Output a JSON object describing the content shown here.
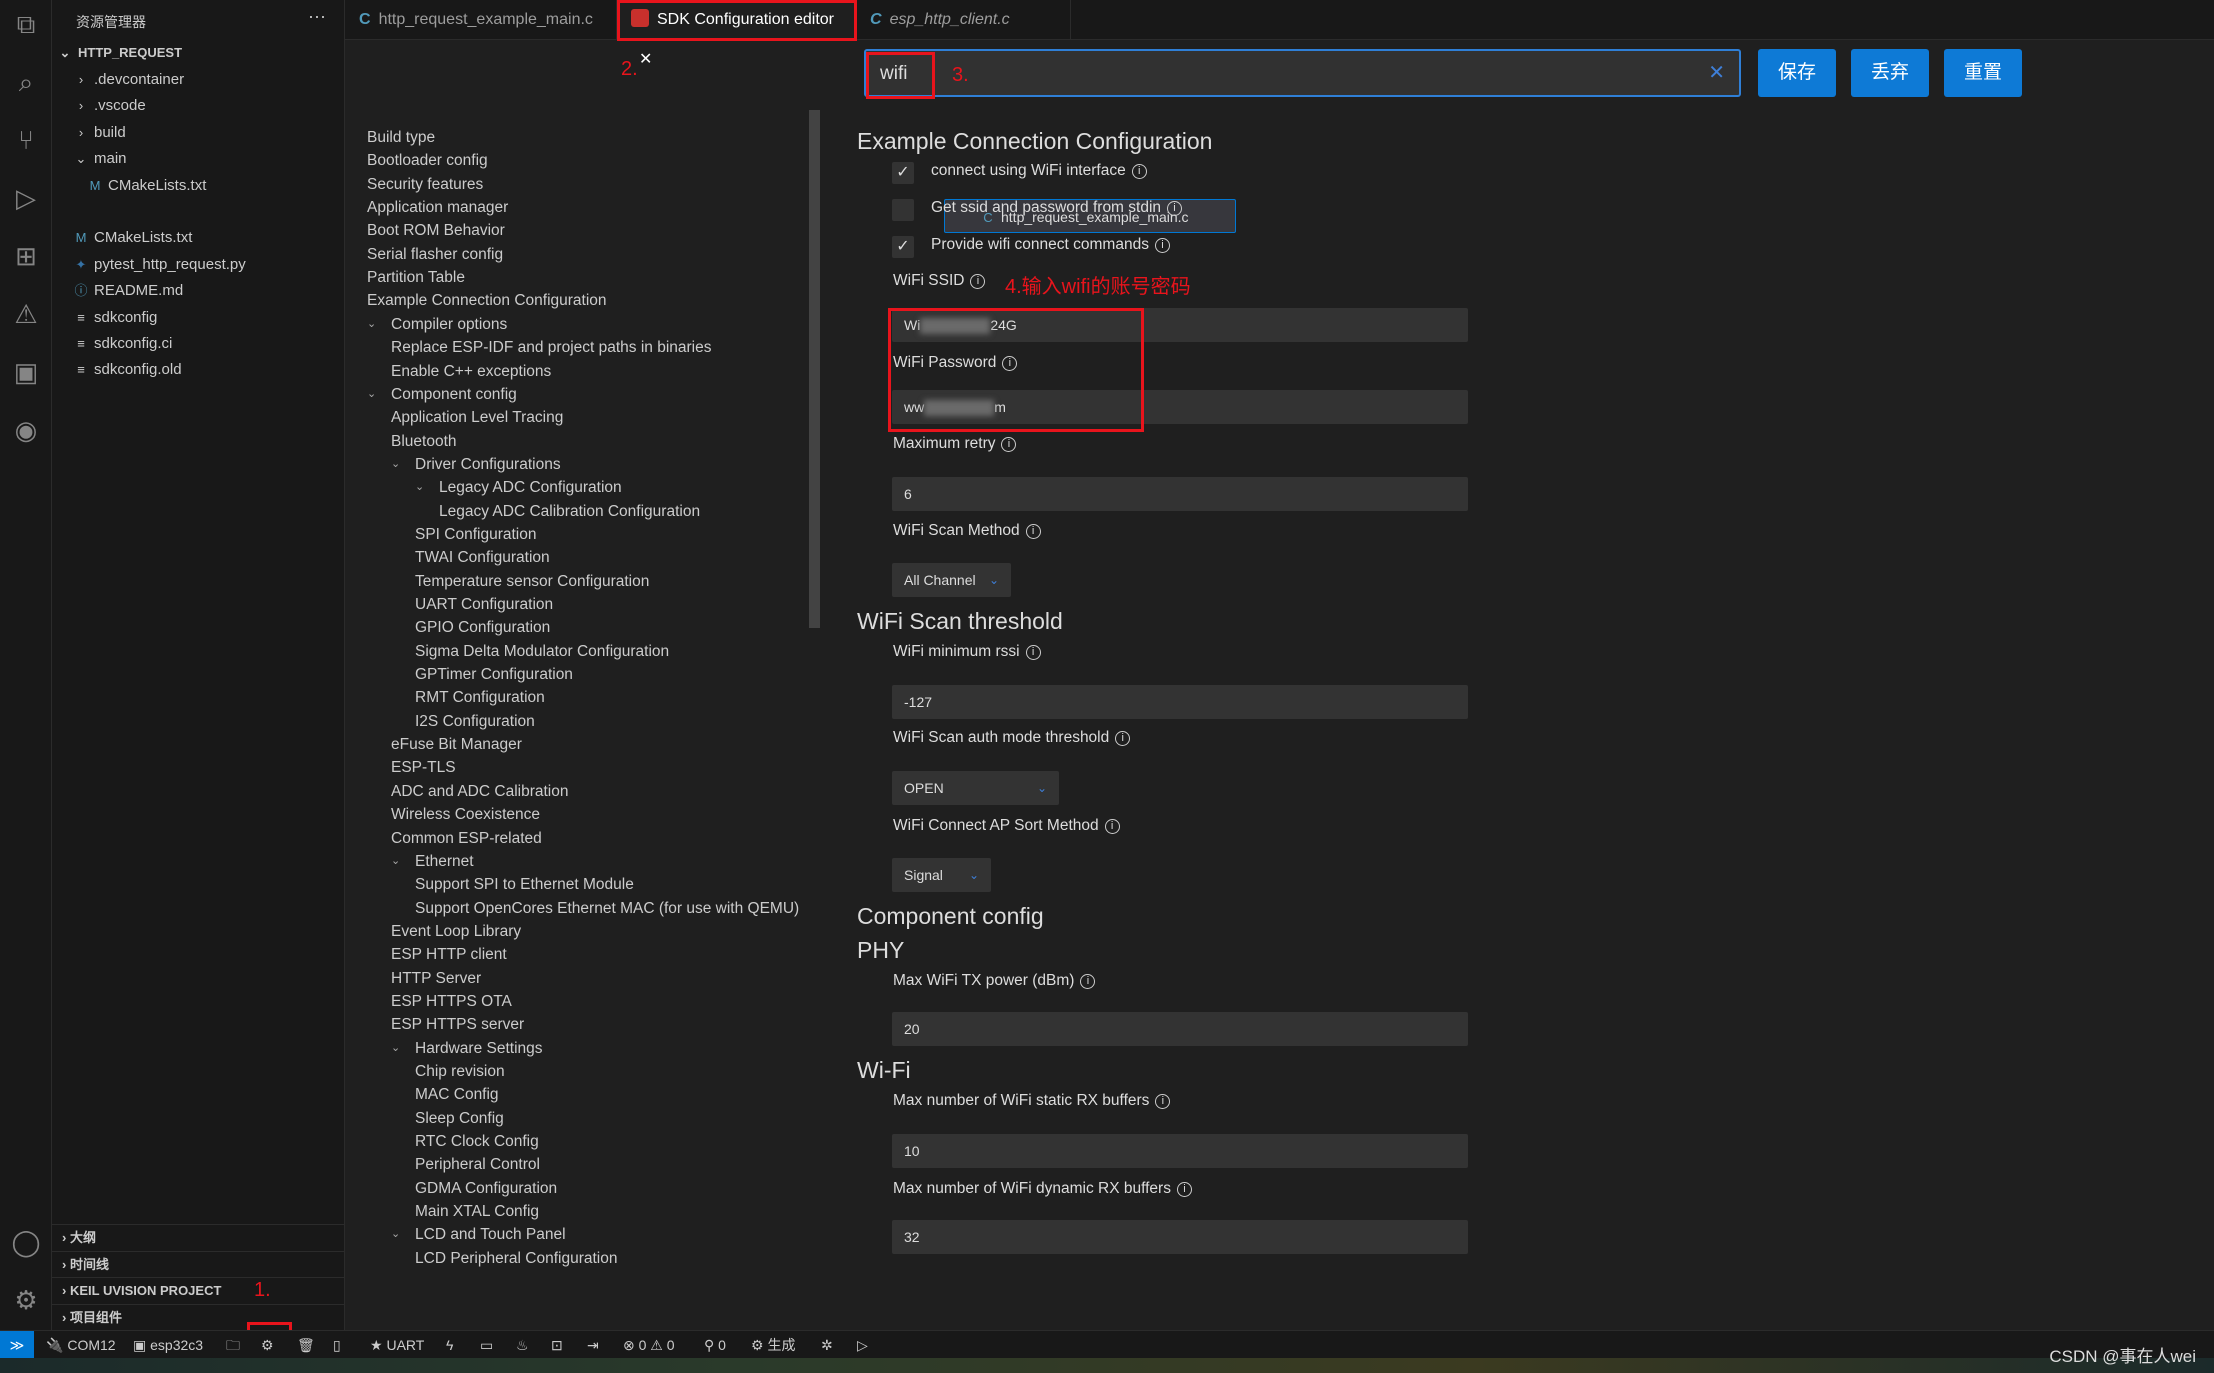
{
  "sidebar": {
    "title": "资源管理器",
    "more": "···",
    "root": "HTTP_REQUEST",
    "files": [
      {
        "name": ".devcontainer",
        "icon": "chevron-right",
        "level": 1
      },
      {
        "name": ".vscode",
        "icon": "chevron-right",
        "level": 1
      },
      {
        "name": "build",
        "icon": "chevron-right",
        "level": 1
      },
      {
        "name": "main",
        "icon": "chevron-down",
        "level": 1
      },
      {
        "name": "CMakeLists.txt",
        "icon": "M",
        "level": 2
      },
      {
        "name": "http_request_example_main.c",
        "icon": "C",
        "level": 2,
        "selected": true
      },
      {
        "name": "CMakeLists.txt",
        "icon": "M",
        "level": 1
      },
      {
        "name": "pytest_http_request.py",
        "icon": "py",
        "level": 1
      },
      {
        "name": "README.md",
        "icon": "info",
        "level": 1
      },
      {
        "name": "sdkconfig",
        "icon": "lines",
        "level": 1
      },
      {
        "name": "sdkconfig.ci",
        "icon": "lines",
        "level": 1
      },
      {
        "name": "sdkconfig.old",
        "icon": "lines",
        "level": 1
      }
    ],
    "panels": [
      "大纲",
      "时间线",
      "KEIL UVISION PROJECT",
      "项目组件"
    ]
  },
  "tabs": [
    {
      "label": "http_request_example_main.c",
      "icon": "C"
    },
    {
      "label": "SDK Configuration editor",
      "icon": "espressif",
      "active": true,
      "close": "✕"
    },
    {
      "label": "esp_http_client.c",
      "icon": "C"
    }
  ],
  "tree": [
    [
      "Build type",
      0
    ],
    [
      "Bootloader config",
      0
    ],
    [
      "Security features",
      0
    ],
    [
      "Application manager",
      0
    ],
    [
      "Boot ROM Behavior",
      0
    ],
    [
      "Serial flasher config",
      0
    ],
    [
      "Partition Table",
      0
    ],
    [
      "Example Connection Configuration",
      0
    ],
    [
      "Compiler options",
      1,
      true
    ],
    [
      "Replace ESP-IDF and project paths in binaries",
      1
    ],
    [
      "Enable C++ exceptions",
      1
    ],
    [
      "Component config",
      1,
      true
    ],
    [
      "Application Level Tracing",
      1
    ],
    [
      "Bluetooth",
      1
    ],
    [
      "Driver Configurations",
      2,
      true
    ],
    [
      "Legacy ADC Configuration",
      3,
      true
    ],
    [
      "Legacy ADC Calibration Configuration",
      3
    ],
    [
      "SPI Configuration",
      2
    ],
    [
      "TWAI Configuration",
      2
    ],
    [
      "Temperature sensor Configuration",
      2
    ],
    [
      "UART Configuration",
      2
    ],
    [
      "GPIO Configuration",
      2
    ],
    [
      "Sigma Delta Modulator Configuration",
      2
    ],
    [
      "GPTimer Configuration",
      2
    ],
    [
      "RMT Configuration",
      2
    ],
    [
      "I2S Configuration",
      2
    ],
    [
      "eFuse Bit Manager",
      1
    ],
    [
      "ESP-TLS",
      1
    ],
    [
      "ADC and ADC Calibration",
      1
    ],
    [
      "Wireless Coexistence",
      1
    ],
    [
      "Common ESP-related",
      1
    ],
    [
      "Ethernet",
      2,
      true
    ],
    [
      "Support SPI to Ethernet Module",
      2
    ],
    [
      "Support OpenCores Ethernet MAC (for use with QEMU)",
      2
    ],
    [
      "Event Loop Library",
      1
    ],
    [
      "ESP HTTP client",
      1
    ],
    [
      "HTTP Server",
      1
    ],
    [
      "ESP HTTPS OTA",
      1
    ],
    [
      "ESP HTTPS server",
      1
    ],
    [
      "Hardware Settings",
      2,
      true
    ],
    [
      "Chip revision",
      2
    ],
    [
      "MAC Config",
      2
    ],
    [
      "Sleep Config",
      2
    ],
    [
      "RTC Clock Config",
      2
    ],
    [
      "Peripheral Control",
      2
    ],
    [
      "GDMA Configuration",
      2
    ],
    [
      "Main XTAL Config",
      2
    ],
    [
      "LCD and Touch Panel",
      2,
      true
    ],
    [
      "LCD Peripheral Configuration",
      2
    ]
  ],
  "search": {
    "value": "wifi",
    "clear": "✕"
  },
  "buttons": {
    "save": "保存",
    "discard": "丢弃",
    "reset": "重置"
  },
  "config": {
    "h1": "Example Connection Configuration",
    "connect_wifi": {
      "label": "connect using WiFi interface",
      "checked": true
    },
    "stdin": {
      "label": "Get ssid and password from stdin",
      "checked": false
    },
    "provide_cmds": {
      "label": "Provide wifi connect commands",
      "checked": true
    },
    "ssid_label": "WiFi SSID",
    "ssid_prefix": "Wi",
    "ssid_suffix": "24G",
    "pwd_label": "WiFi Password",
    "pwd_prefix": "ww",
    "pwd_suffix": "m",
    "retry_label": "Maximum retry",
    "retry": "6",
    "scan_method_label": "WiFi Scan Method",
    "scan_method": "All Channel",
    "h2": "WiFi Scan threshold",
    "rssi_label": "WiFi minimum rssi",
    "rssi": "-127",
    "auth_label": "WiFi Scan auth mode threshold",
    "auth": "OPEN",
    "sort_label": "WiFi Connect AP Sort Method",
    "sort": "Signal",
    "h3": "Component config",
    "h4": "PHY",
    "tx_label": "Max WiFi TX power (dBm)",
    "tx": "20",
    "h5": "Wi-Fi",
    "static_rx_label": "Max number of WiFi static RX buffers",
    "static_rx": "10",
    "dyn_rx_label": "Max number of WiFi dynamic RX buffers",
    "dyn_rx": "32",
    "info": "i",
    "check": "✓"
  },
  "annotations": {
    "a1": "1.",
    "a2": "2.",
    "a3": "3.",
    "a4": "4.输入wifi的账号密码"
  },
  "status": {
    "port": "COM12",
    "chip": "esp32c3",
    "uart": "UART",
    "errors": "0",
    "warnings": "0",
    "other": "0",
    "build": "生成"
  },
  "watermark": "CSDN @事在人wei"
}
